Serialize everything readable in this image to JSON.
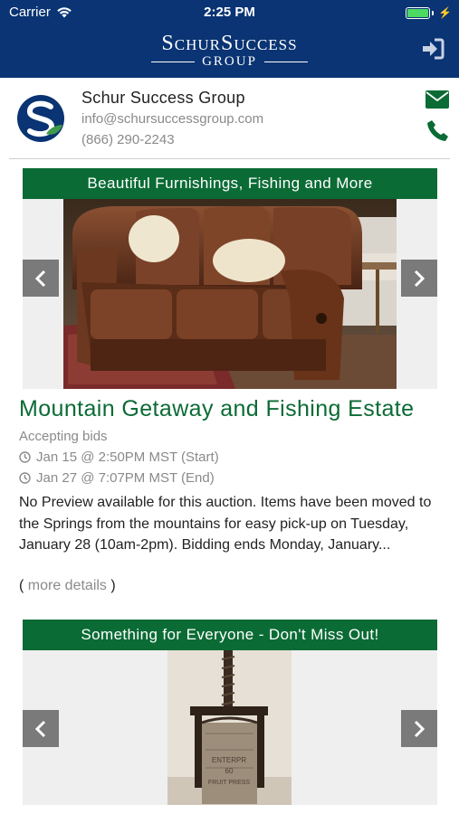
{
  "status_bar": {
    "carrier": "Carrier",
    "time": "2:25 PM"
  },
  "nav": {
    "logo_line1": "SchurSuccess",
    "logo_line2": "GROUP",
    "login_icon": "sign-in-icon"
  },
  "company": {
    "name": "Schur Success Group",
    "email": "info@schursuccessgroup.com",
    "phone": "(866) 290-2243",
    "mail_icon": "envelope-icon",
    "call_icon": "phone-icon"
  },
  "listings": [
    {
      "banner": "Beautiful Furnishings, Fishing and More",
      "title": "Mountain Getaway and Fishing Estate",
      "status": "Accepting bids",
      "start": "Jan 15 @ 2:50PM MST (Start)",
      "end": "Jan 27 @ 7:07PM MST (End)",
      "description": "No Preview available for this auction. Items have been moved to the Springs from the mountains for easy pick-up on Tuesday, January 28 (10am-2pm). Bidding ends Monday, January...",
      "more_open": "( ",
      "more_link": "more details",
      "more_close": " )"
    },
    {
      "banner": "Something for Everyone - Don't Miss Out!",
      "photo_text_1": "ENTERPR",
      "photo_text_2": "60",
      "photo_text_3": "FRUIT PRESS"
    }
  ],
  "colors": {
    "nav_bg": "#0a3473",
    "accent_green": "#0b6b35",
    "muted_text": "#8a8a8a",
    "arrow_bg": "#7a7a7a"
  }
}
